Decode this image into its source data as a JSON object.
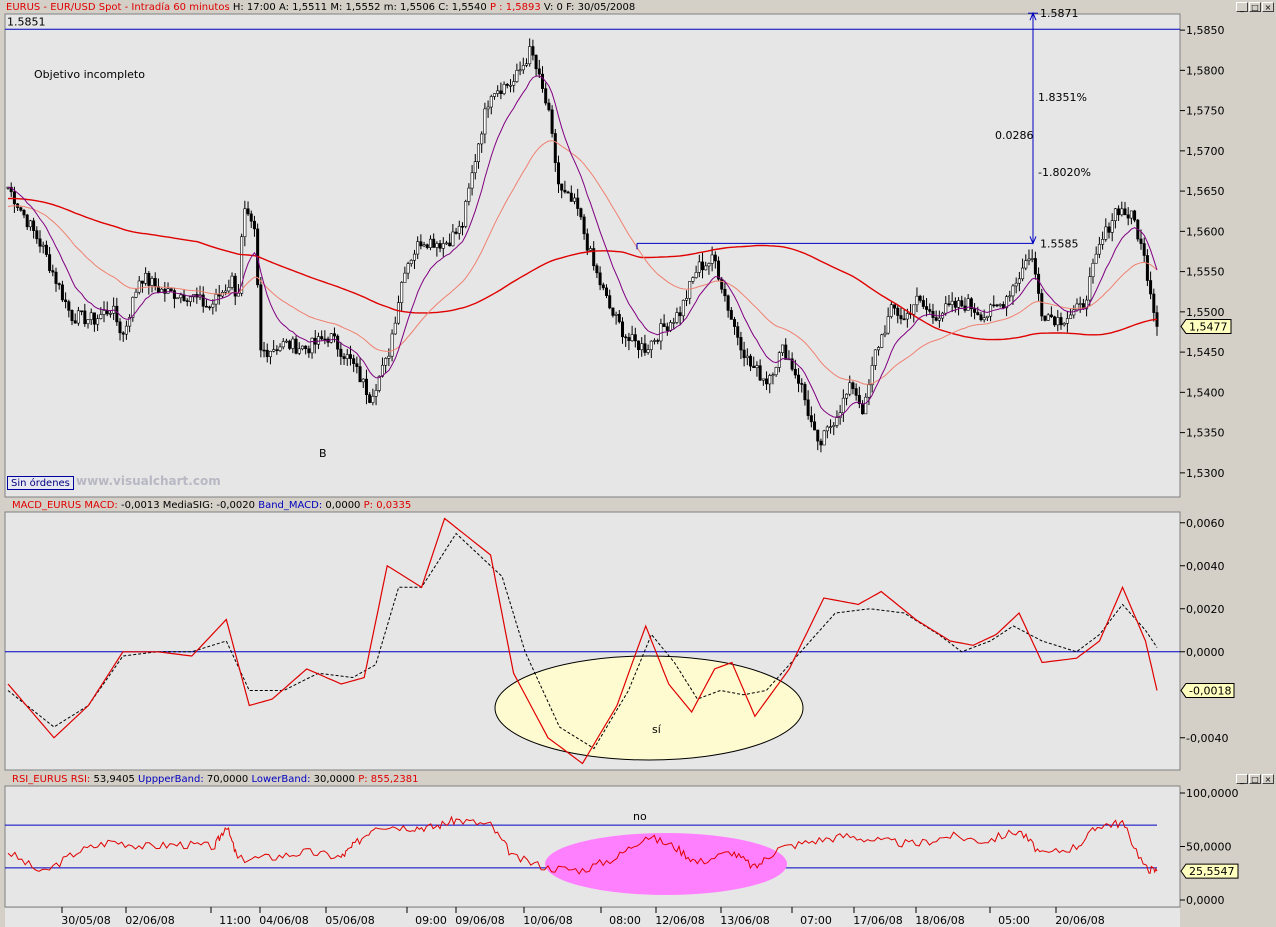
{
  "price_header": {
    "symbol": "EURUS - EUR/USD Spot - Intradía 60 minutos",
    "h_label": "H:",
    "h_value": "17:00",
    "a_label": "A:",
    "a_value": "1,5511",
    "m_label": "M:",
    "m_value": "1,5552",
    "mm_label": "m:",
    "mm_value": "1,5506",
    "c_label": "C:",
    "c_value": "1,5540",
    "p_label": "P :",
    "p_value": "1,5893",
    "v_label": "V:",
    "v_value": "0",
    "f_label": "F:",
    "f_value": "30/05/2008"
  },
  "macd_header": {
    "name": "MACD_EURUS",
    "macd_label": "MACD:",
    "macd_value": "-0,0013",
    "sig_label": "MediaSIG:",
    "sig_value": "-0,0020",
    "band_label": "Band_MACD:",
    "band_value": "0,0000",
    "p_label": "P:",
    "p_value": "0,0335"
  },
  "rsi_header": {
    "name": "RSI_EURUS",
    "rsi_label": "RSI:",
    "rsi_value": "53,9405",
    "upper_label": "UppperBand:",
    "upper_value": "70,0000",
    "lower_label": "LowerBand:",
    "lower_value": "30,0000",
    "p_label": "P:",
    "p_value": "855,2381"
  },
  "window_buttons": {
    "minimize": "_",
    "maximize": "□",
    "close": "×"
  },
  "annotations": {
    "objective": "Objetivo incompleto",
    "b_mark": "B",
    "level_1585": "1.5851",
    "level_1587": "1.5871",
    "level_1558": "1.5585",
    "pct_up": "1.8351%",
    "pct_down": "-1.8020%",
    "delta": "0.0286",
    "macd_ellipse": "sí",
    "rsi_ellipse": "no"
  },
  "badges": {
    "sin_ordenes": "Sin órdenes",
    "visualchart": "www.visualchart.com"
  },
  "colors": {
    "price_bg": "#e6e6e6",
    "panel_bg": "#e6e6e6",
    "accent": "#0000c0",
    "red": "#e00000",
    "purple": "#800080",
    "salmon": "#f08070",
    "ellipse_macd": "#fffbd0",
    "ellipse_rsi": "#ff80ff"
  },
  "chart_data": [
    {
      "type": "candlestick",
      "title": "EURUS - EUR/USD Spot - Intradía 60 minutos",
      "ylim": [
        1.527,
        1.587
      ],
      "yticks": [
        "1,5850",
        "1,5800",
        "1,5750",
        "1,5700",
        "1,5650",
        "1,5600",
        "1,5550",
        "1,5500",
        "1,5450",
        "1,5400",
        "1,5350",
        "1,5300"
      ],
      "last_price": "1,5477",
      "x_labels": [
        "30/05/08",
        "02/06/08",
        "11:00",
        "04/06/08",
        "05/06/08",
        "09:00",
        "09/06/08",
        "10/06/08",
        "08:00",
        "12/06/08",
        "13/06/08",
        "07:00",
        "17/06/08",
        "18/06/08",
        "05:00",
        "20/06/08"
      ],
      "close_path": [
        [
          0,
          1.5655
        ],
        [
          0.03,
          1.558
        ],
        [
          0.055,
          1.5495
        ],
        [
          0.075,
          1.549
        ],
        [
          0.09,
          1.5505
        ],
        [
          0.1,
          1.547
        ],
        [
          0.115,
          1.5545
        ],
        [
          0.135,
          1.5525
        ],
        [
          0.16,
          1.552
        ],
        [
          0.175,
          1.5505
        ],
        [
          0.195,
          1.554
        ],
        [
          0.2,
          1.5515
        ],
        [
          0.205,
          1.5625
        ],
        [
          0.215,
          1.5595
        ],
        [
          0.22,
          1.545
        ],
        [
          0.24,
          1.546
        ],
        [
          0.26,
          1.5455
        ],
        [
          0.28,
          1.547
        ],
        [
          0.3,
          1.5435
        ],
        [
          0.315,
          1.5395
        ],
        [
          0.33,
          1.544
        ],
        [
          0.345,
          1.5555
        ],
        [
          0.36,
          1.559
        ],
        [
          0.38,
          1.5585
        ],
        [
          0.395,
          1.5605
        ],
        [
          0.41,
          1.5715
        ],
        [
          0.42,
          1.5775
        ],
        [
          0.44,
          1.5785
        ],
        [
          0.455,
          1.5825
        ],
        [
          0.47,
          1.575
        ],
        [
          0.48,
          1.565
        ],
        [
          0.495,
          1.563
        ],
        [
          0.51,
          1.5555
        ],
        [
          0.525,
          1.55
        ],
        [
          0.54,
          1.5465
        ],
        [
          0.555,
          1.5455
        ],
        [
          0.57,
          1.548
        ],
        [
          0.585,
          1.55
        ],
        [
          0.6,
          1.5555
        ],
        [
          0.615,
          1.5565
        ],
        [
          0.63,
          1.549
        ],
        [
          0.645,
          1.5435
        ],
        [
          0.66,
          1.5415
        ],
        [
          0.675,
          1.5455
        ],
        [
          0.69,
          1.541
        ],
        [
          0.705,
          1.533
        ],
        [
          0.72,
          1.537
        ],
        [
          0.735,
          1.541
        ],
        [
          0.745,
          1.5375
        ],
        [
          0.755,
          1.545
        ],
        [
          0.77,
          1.5505
        ],
        [
          0.78,
          1.549
        ],
        [
          0.79,
          1.5515
        ],
        [
          0.805,
          1.5495
        ],
        [
          0.82,
          1.5505
        ],
        [
          0.835,
          1.551
        ],
        [
          0.85,
          1.5495
        ],
        [
          0.865,
          1.551
        ],
        [
          0.88,
          1.5545
        ],
        [
          0.89,
          1.5575
        ],
        [
          0.9,
          1.55
        ],
        [
          0.915,
          1.549
        ],
        [
          0.935,
          1.5505
        ],
        [
          0.95,
          1.558
        ],
        [
          0.965,
          1.563
        ],
        [
          0.98,
          1.5615
        ],
        [
          0.99,
          1.556
        ],
        [
          1.0,
          1.5485
        ]
      ]
    },
    {
      "type": "line",
      "title": "MACD_EURUS",
      "ylim": [
        -0.0055,
        0.0065
      ],
      "yticks": [
        "0,0060",
        "0,0040",
        "0,0020",
        "0,0000",
        "-0,0040"
      ],
      "last_value": "-0,0018",
      "band": 0.0,
      "series": [
        {
          "name": "MACD",
          "points": [
            [
              0,
              -0.0015
            ],
            [
              0.04,
              -0.004
            ],
            [
              0.07,
              -0.0025
            ],
            [
              0.1,
              0
            ],
            [
              0.13,
              0
            ],
            [
              0.16,
              -0.0002
            ],
            [
              0.19,
              0.0015
            ],
            [
              0.21,
              -0.0025
            ],
            [
              0.23,
              -0.0022
            ],
            [
              0.26,
              -0.0008
            ],
            [
              0.29,
              -0.0015
            ],
            [
              0.31,
              -0.0012
            ],
            [
              0.33,
              0.004
            ],
            [
              0.36,
              0.003
            ],
            [
              0.38,
              0.0062
            ],
            [
              0.42,
              0.0045
            ],
            [
              0.44,
              -0.001
            ],
            [
              0.47,
              -0.004
            ],
            [
              0.5,
              -0.0052
            ],
            [
              0.53,
              -0.0025
            ],
            [
              0.555,
              0.0012
            ],
            [
              0.575,
              -0.0015
            ],
            [
              0.595,
              -0.0028
            ],
            [
              0.615,
              -0.0008
            ],
            [
              0.63,
              -0.0005
            ],
            [
              0.65,
              -0.003
            ],
            [
              0.68,
              -0.0008
            ],
            [
              0.71,
              0.0025
            ],
            [
              0.74,
              0.0022
            ],
            [
              0.76,
              0.0028
            ],
            [
              0.79,
              0.0015
            ],
            [
              0.82,
              0.0005
            ],
            [
              0.84,
              0.0003
            ],
            [
              0.86,
              0.0008
            ],
            [
              0.88,
              0.0018
            ],
            [
              0.9,
              -0.0005
            ],
            [
              0.93,
              -0.0003
            ],
            [
              0.95,
              0.0005
            ],
            [
              0.97,
              0.003
            ],
            [
              0.99,
              0.0005
            ],
            [
              1.0,
              -0.0018
            ]
          ]
        },
        {
          "name": "MediaSIG",
          "points": [
            [
              0,
              -0.0018
            ],
            [
              0.04,
              -0.0035
            ],
            [
              0.07,
              -0.0025
            ],
            [
              0.1,
              -0.0002
            ],
            [
              0.13,
              0
            ],
            [
              0.16,
              0
            ],
            [
              0.19,
              0.0005
            ],
            [
              0.21,
              -0.0018
            ],
            [
              0.24,
              -0.0018
            ],
            [
              0.27,
              -0.001
            ],
            [
              0.3,
              -0.0012
            ],
            [
              0.32,
              -0.0006
            ],
            [
              0.34,
              0.003
            ],
            [
              0.36,
              0.003
            ],
            [
              0.39,
              0.0055
            ],
            [
              0.43,
              0.0035
            ],
            [
              0.45,
              0
            ],
            [
              0.48,
              -0.0035
            ],
            [
              0.51,
              -0.0045
            ],
            [
              0.54,
              -0.0018
            ],
            [
              0.56,
              0.0008
            ],
            [
              0.58,
              -0.0005
            ],
            [
              0.6,
              -0.0022
            ],
            [
              0.62,
              -0.0018
            ],
            [
              0.64,
              -0.002
            ],
            [
              0.66,
              -0.0018
            ],
            [
              0.69,
              0
            ],
            [
              0.72,
              0.0018
            ],
            [
              0.75,
              0.002
            ],
            [
              0.78,
              0.0018
            ],
            [
              0.81,
              0.0008
            ],
            [
              0.83,
              0
            ],
            [
              0.855,
              0.0005
            ],
            [
              0.875,
              0.0012
            ],
            [
              0.9,
              0.0005
            ],
            [
              0.93,
              0
            ],
            [
              0.95,
              0.0008
            ],
            [
              0.97,
              0.0022
            ],
            [
              0.99,
              0.001
            ],
            [
              1.0,
              0.0002
            ]
          ]
        }
      ]
    },
    {
      "type": "line",
      "title": "RSI_EURUS",
      "ylim": [
        0,
        100
      ],
      "yticks": [
        "100,0000",
        "50,0000",
        "0,0000"
      ],
      "last_value": "25,5547",
      "upper_band": 70,
      "lower_band": 30,
      "series": [
        {
          "name": "RSI",
          "points": [
            [
              0,
              45
            ],
            [
              0.03,
              25
            ],
            [
              0.06,
              45
            ],
            [
              0.09,
              55
            ],
            [
              0.12,
              50
            ],
            [
              0.15,
              52
            ],
            [
              0.18,
              50
            ],
            [
              0.19,
              70
            ],
            [
              0.2,
              38
            ],
            [
              0.23,
              40
            ],
            [
              0.26,
              45
            ],
            [
              0.29,
              40
            ],
            [
              0.3,
              50
            ],
            [
              0.32,
              70
            ],
            [
              0.35,
              68
            ],
            [
              0.37,
              68
            ],
            [
              0.39,
              75
            ],
            [
              0.42,
              70
            ],
            [
              0.44,
              40
            ],
            [
              0.47,
              30
            ],
            [
              0.5,
              28
            ],
            [
              0.53,
              40
            ],
            [
              0.555,
              60
            ],
            [
              0.58,
              50
            ],
            [
              0.6,
              35
            ],
            [
              0.63,
              45
            ],
            [
              0.65,
              30
            ],
            [
              0.67,
              48
            ],
            [
              0.7,
              55
            ],
            [
              0.73,
              60
            ],
            [
              0.76,
              55
            ],
            [
              0.79,
              52
            ],
            [
              0.82,
              60
            ],
            [
              0.85,
              55
            ],
            [
              0.88,
              65
            ],
            [
              0.9,
              42
            ],
            [
              0.93,
              50
            ],
            [
              0.95,
              70
            ],
            [
              0.97,
              72
            ],
            [
              0.99,
              30
            ],
            [
              1.0,
              27
            ]
          ]
        }
      ]
    }
  ]
}
